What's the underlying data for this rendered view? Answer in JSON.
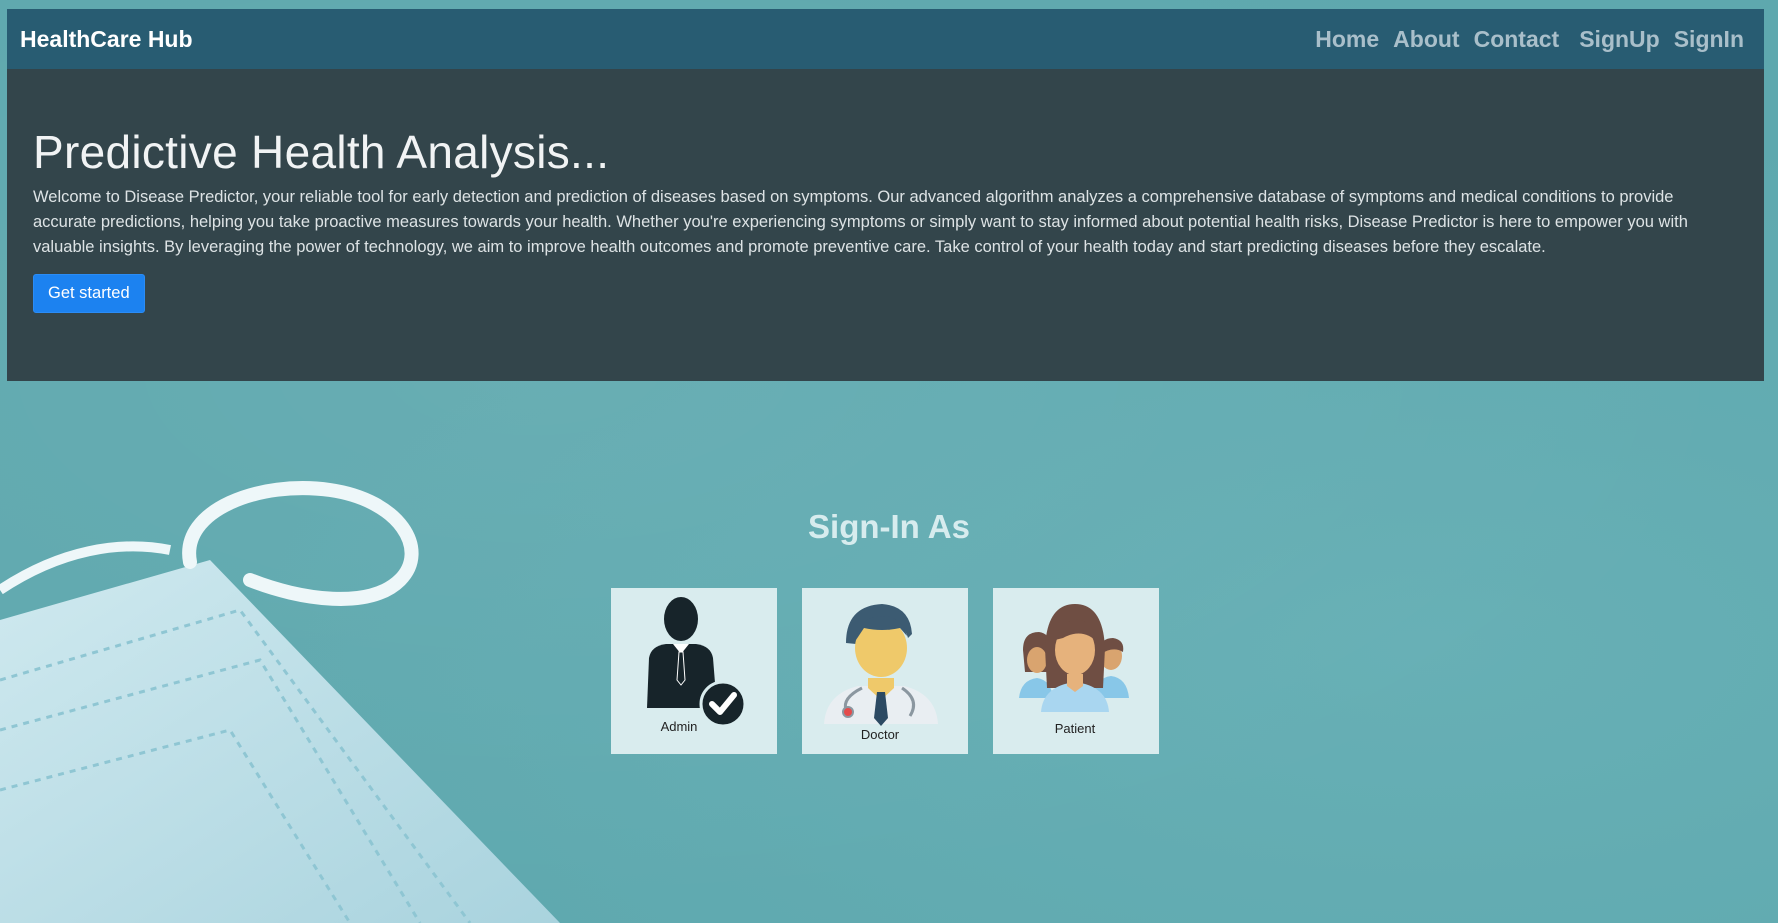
{
  "navbar": {
    "brand": "HealthCare Hub",
    "links": [
      "Home",
      "About",
      "Contact",
      "SignUp",
      "SignIn"
    ]
  },
  "hero": {
    "title": "Predictive Health Analysis...",
    "description": "Welcome to Disease Predictor, your reliable tool for early detection and prediction of diseases based on symptoms. Our advanced algorithm analyzes a comprehensive database of symptoms and medical conditions to provide accurate predictions, helping you take proactive measures towards your health. Whether you're experiencing symptoms or simply want to stay informed about potential health risks, Disease Predictor is here to empower you with valuable insights. By leveraging the power of technology, we aim to improve health outcomes and promote preventive care. Take control of your health today and start predicting diseases before they escalate.",
    "cta_label": "Get started"
  },
  "signin": {
    "title": "Sign-In As",
    "roles": [
      "Admin",
      "Doctor",
      "Patient"
    ]
  },
  "colors": {
    "navbar_bg": "#285c72",
    "hero_bg": "#33454b",
    "button_bg": "#1c82f0",
    "page_bg": "#5ea8ae",
    "card_bg": "#d9ecee"
  },
  "icons": {
    "admin": "admin-user-check-icon",
    "doctor": "doctor-icon",
    "patient": "patient-group-icon"
  }
}
